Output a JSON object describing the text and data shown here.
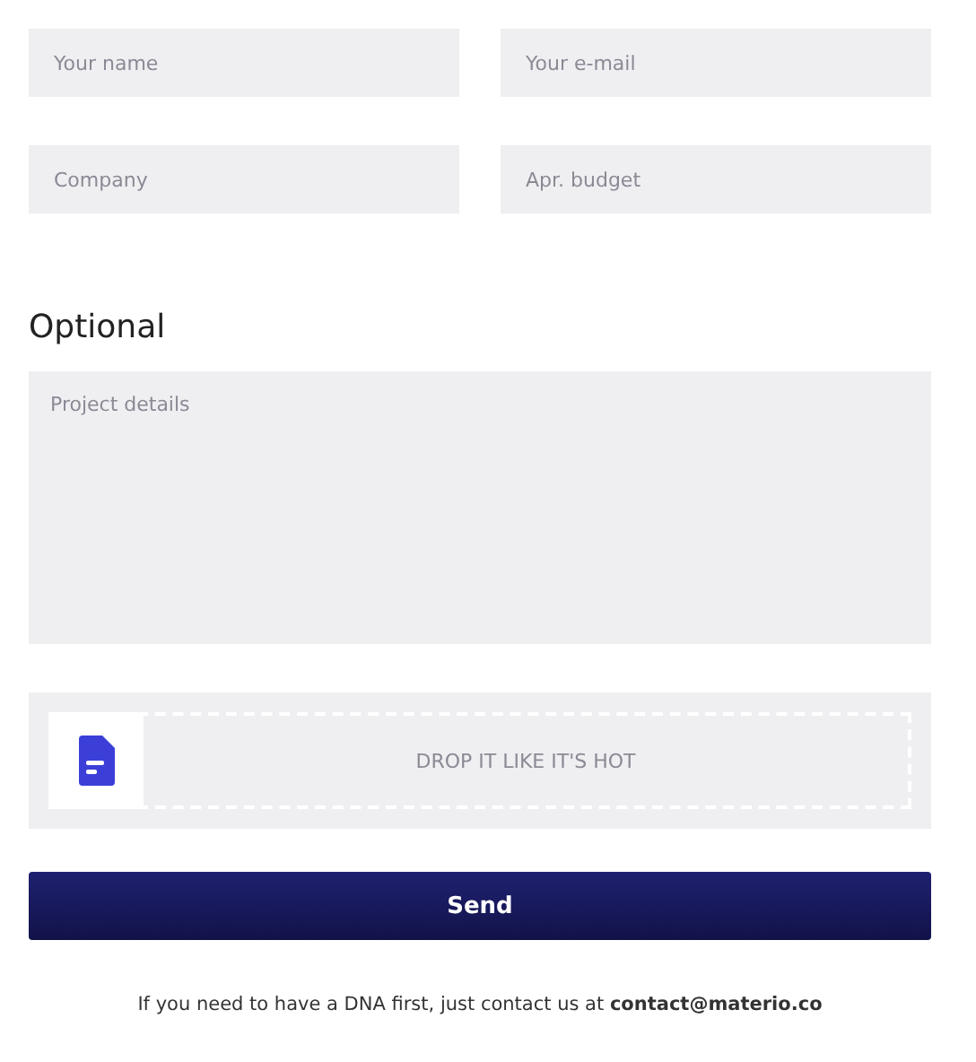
{
  "fields": [
    {
      "placeholder": "Your name"
    },
    {
      "placeholder": "Your e-mail"
    },
    {
      "placeholder": "Company"
    },
    {
      "placeholder": "Apr. budget"
    }
  ],
  "optional": {
    "heading": "Optional",
    "details": {
      "placeholder": "Project details"
    }
  },
  "dropzone": {
    "label": "DROP IT LIKE IT'S HOT"
  },
  "button": "Send",
  "footer": "If you need to have a DNA first, just contact us at **contact@materio.co**"
}
